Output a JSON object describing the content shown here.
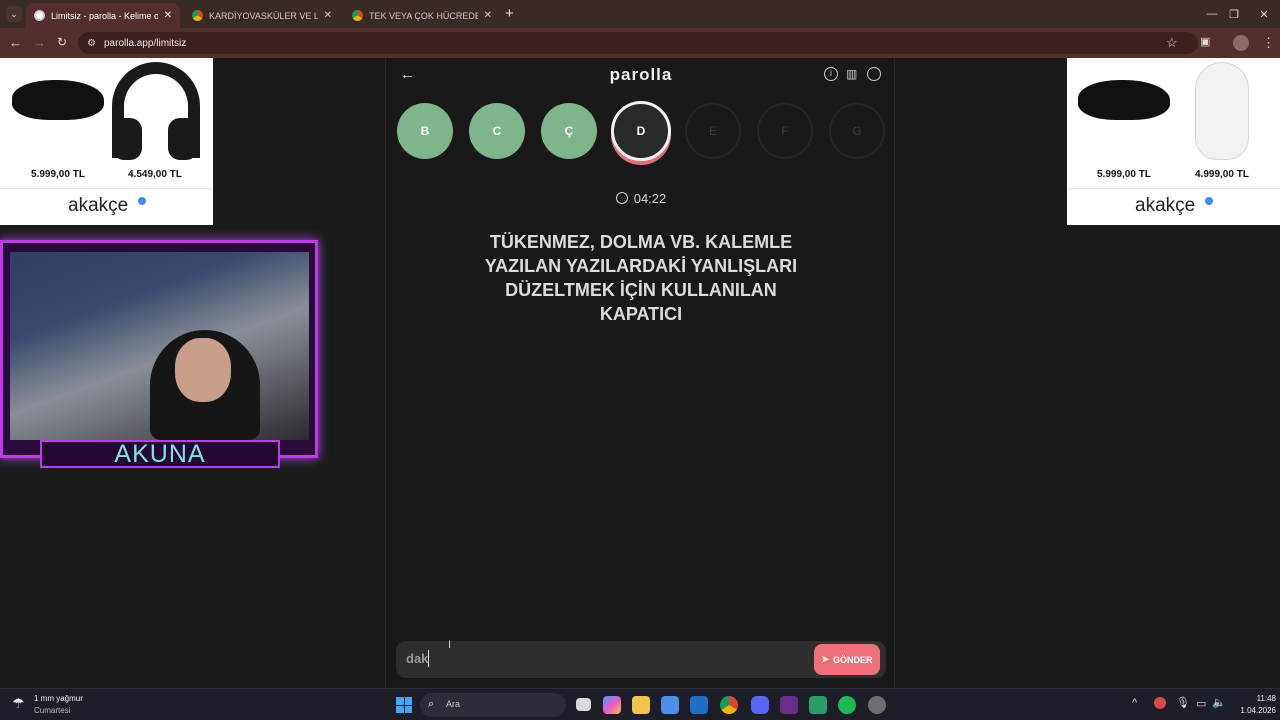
{
  "browser": {
    "tabs": [
      {
        "title": "Limitsiz - parolla - Kelime oyunu",
        "active": true
      },
      {
        "title": "KARDİYOVASKÜLER VE LENFATİ",
        "active": false
      },
      {
        "title": "TEK VEYA ÇOK HÜCREDEN OLU",
        "active": false
      }
    ],
    "url": "parolla.app/limitsiz",
    "new_tab": "+"
  },
  "ads": {
    "left": {
      "prices": [
        "5.999,00 TL",
        "4.549,00 TL"
      ],
      "brand": "akakçe"
    },
    "right": {
      "prices": [
        "5.999,00 TL",
        "4.999,00 TL"
      ],
      "brand": "akakçe"
    }
  },
  "stream": {
    "name": "AKUNA"
  },
  "game": {
    "logo": "parolla",
    "letters": [
      {
        "letter": "B",
        "state": "correct"
      },
      {
        "letter": "C",
        "state": "correct"
      },
      {
        "letter": "Ç",
        "state": "correct"
      },
      {
        "letter": "D",
        "state": "current"
      },
      {
        "letter": "E",
        "state": "pending"
      },
      {
        "letter": "F",
        "state": "pending"
      },
      {
        "letter": "G",
        "state": "pending"
      }
    ],
    "timer": "04:22",
    "question_lines": [
      "TÜKENMEZ, DOLMA VB. KALEMLE",
      "YAZILAN YAZILARDAKİ YANLIŞLARI",
      "DÜZELTMEK İÇİN KULLANILAN",
      "KAPATICI"
    ],
    "answer": "dak",
    "submit_label": "GÖNDER"
  },
  "taskbar": {
    "weather_temp": "1 mm yağmur",
    "weather_day": "Cumartesi",
    "search": "Ara",
    "time": "11:48",
    "date": "1.04.2026"
  },
  "colors": {
    "correct": "#7fb58b",
    "accent": "#f0707a",
    "tab_bg": "#522f2c"
  }
}
